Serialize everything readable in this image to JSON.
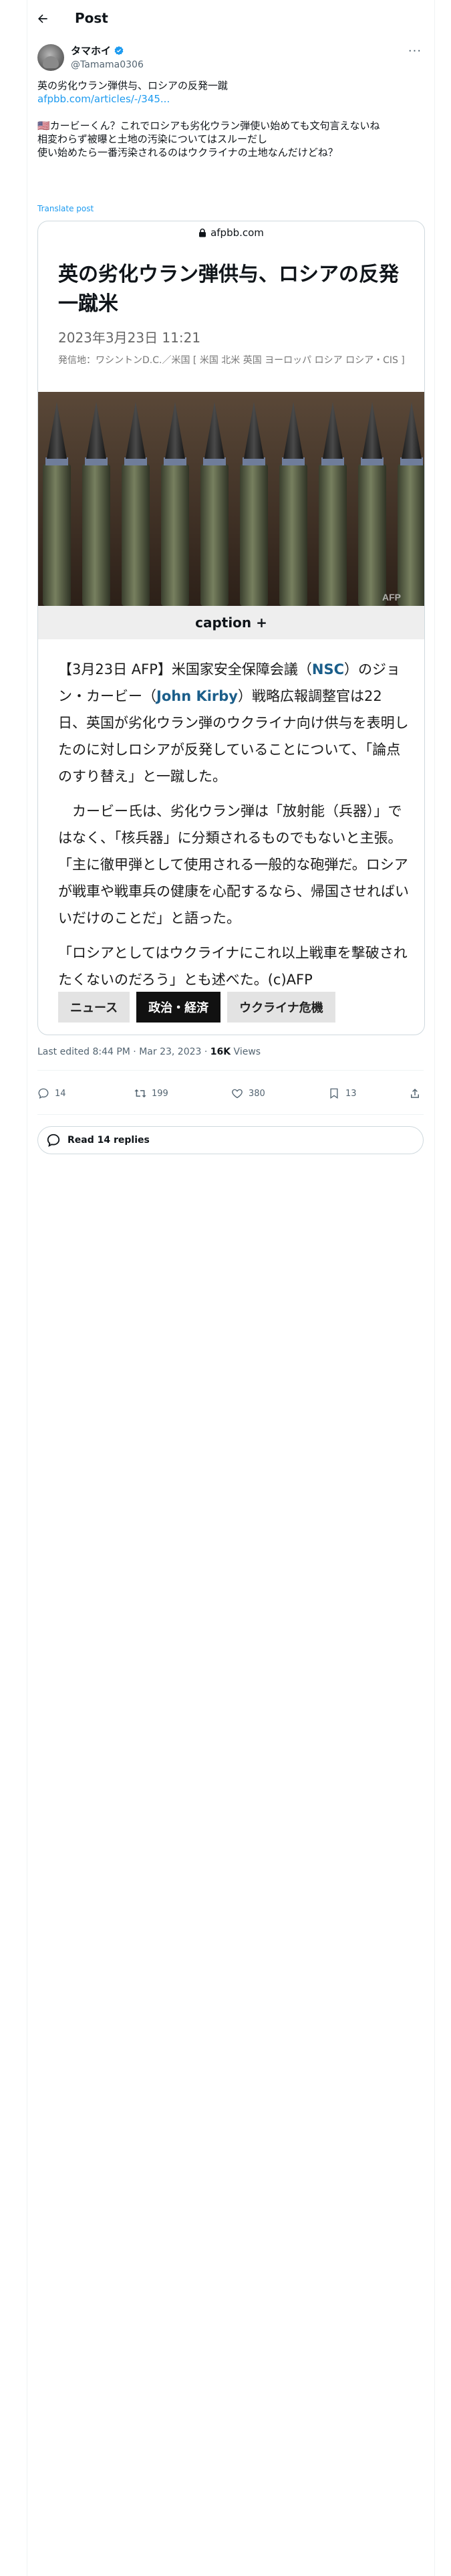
{
  "header": {
    "title": "Post"
  },
  "author": {
    "display_name": "タマホイ",
    "handle": "@Tamama0306"
  },
  "tweet": {
    "line1": "英の劣化ウラン弾供与、ロシアの反発一蹴",
    "link": "afpbb.com/articles/-/345...",
    "body": "🇺🇸カービーくん？これでロシアも劣化ウラン弾使い始めても文句言えないね\n相変わらず被曝と土地の汚染についてはスルーだし\n使い始めたら一番汚染されるのはウクライナの土地なんだけどね？",
    "translate": "Translate post"
  },
  "card": {
    "domain": "afpbb.com",
    "headline": "英の劣化ウラン弾供与、ロシアの反発一蹴米",
    "date": "2023年3月23日 11:21",
    "location": "発信地：ワシントンD.C.／米国 [ 米国 北米 英国 ヨーロッパ ロシア ロシア・CIS ]",
    "photo_watermark": "AFP",
    "caption": "caption +",
    "p1_a": "【3月23日 AFP】米国家安全保障会議（",
    "p1_kw1": "NSC",
    "p1_b": "）のジョン・カービー（",
    "p1_kw2": "John Kirby",
    "p1_c": "）戦略広報調整官は22日、英国が劣化ウラン弾のウクライナ向け供与を表明したのに対しロシアが反発していることについて、「論点のすり替え」と一蹴した。",
    "p2": "カービー氏は、劣化ウラン弾は「放射能（兵器）」ではなく、「核兵器」に分類されるものでもないと主張。「主に徹甲弾として使用される一般的な砲弾だ。ロシアが戦車や戦車兵の健康を心配するなら、帰国させればいいだけのことだ」と語った。",
    "p3": "「ロシアとしてはウクライナにこれ以上戦車を撃破されたくないのだろう」とも述べた。(c)AFP",
    "tags": [
      "ニュース",
      "政治・経済",
      "ウクライナ危機"
    ]
  },
  "meta": {
    "edited": "Last edited 8:44 PM · Mar 23, 2023 · ",
    "views_count": "16K",
    "views_label": " Views"
  },
  "actions": {
    "replies": "14",
    "reposts": "199",
    "likes": "380",
    "bookmarks": "13"
  },
  "read_replies": "Read 14 replies",
  "colors": {
    "link": "#1d9bf0",
    "verified": "#1d9bf0",
    "border": "#cfd9de",
    "keyword": "#1b5e8a"
  }
}
